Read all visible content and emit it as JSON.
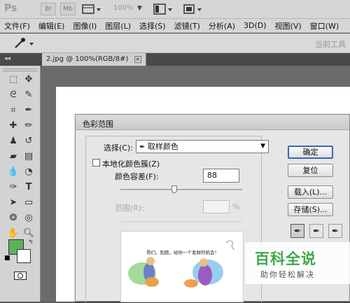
{
  "app": {
    "logo": "Ps",
    "bar_buttons": [
      "Br",
      "Mb"
    ],
    "zoom": "100%"
  },
  "menubar": {
    "items": [
      "文件(F)",
      "编辑(E)",
      "图像(I)",
      "图层(L)",
      "选择(S)",
      "滤镜(T)",
      "分析(A)",
      "3D(D)",
      "视图(V)",
      "窗口(W)"
    ]
  },
  "options_bar": {
    "workspace_label": "当前工具"
  },
  "document_tab": {
    "label": "2.jpg @ 100%(RGB/8#)",
    "close": "×"
  },
  "dialog": {
    "title": "色彩范围",
    "select_label": "选择(C):",
    "select_value": "取样颜色",
    "localized_label": "本地化颜色簇(Z)",
    "fuzziness_label": "颜色容差(F):",
    "fuzziness_value": "88",
    "range_label": "范围(R):",
    "range_unit": "%",
    "preview_caption": "哥们，别跑，给你一个发财的机会！",
    "buttons": {
      "ok": "确定",
      "reset": "复位",
      "load": "载入(L)...",
      "save": "存储(S)..."
    }
  },
  "watermark": {
    "line1": "百科全说",
    "line2": "助你轻松解决"
  },
  "colors": {
    "foreground": "#5cb15c",
    "background": "#ffffff",
    "accent": "#3a66b8",
    "watermark_green": "#3ea84a"
  }
}
